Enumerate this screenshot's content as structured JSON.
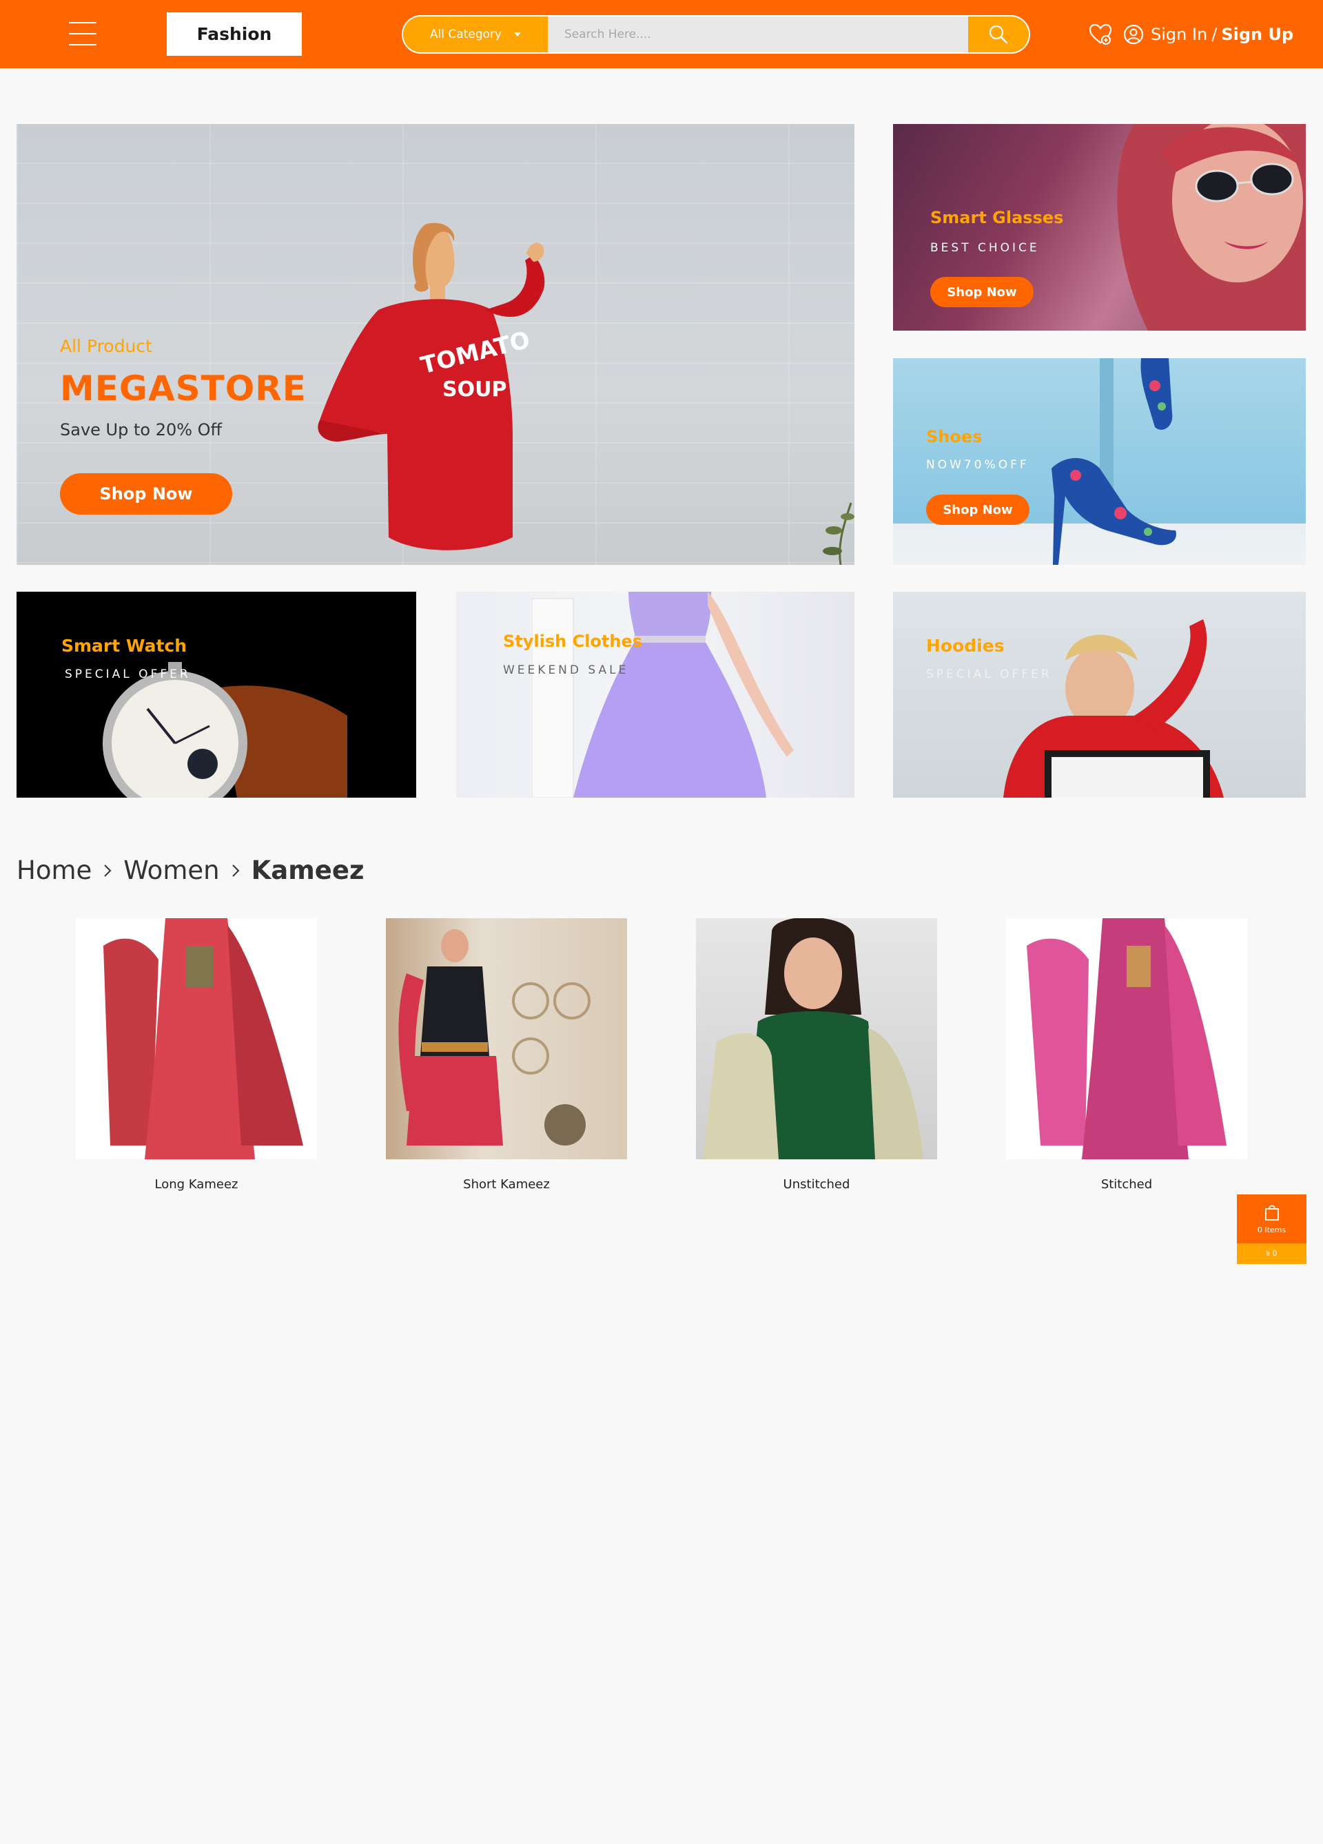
{
  "header": {
    "logo": "Fashion",
    "search": {
      "category": "All Category",
      "placeholder": "Search Here...."
    },
    "auth": {
      "sign_in": "Sign In",
      "separator": "/",
      "sign_up": "Sign Up"
    },
    "icons": [
      "menu-icon",
      "search-icon",
      "wishlist-heart-icon",
      "user-icon"
    ]
  },
  "banners": {
    "main": {
      "category": "All Product",
      "title": "MEGASTORE",
      "subtitle": "Save Up to 20% Off",
      "button": "Shop Now",
      "shirt_text_1": "TOMATO",
      "shirt_text_2": "SOUP"
    },
    "glasses": {
      "title": "Smart Glasses",
      "subtitle": "BEST CHOICE",
      "button": "Shop Now"
    },
    "shoes": {
      "title": "Shoes",
      "subtitle": "NOW70%OFF",
      "button": "Shop Now"
    },
    "watch": {
      "title": "Smart Watch",
      "subtitle": "SPECIAL OFFER"
    },
    "clothes": {
      "title": "Stylish Clothes",
      "subtitle": "WEEKEND SALE"
    },
    "hoodies": {
      "title": "Hoodies",
      "subtitle": "SPECIAL OFFER"
    }
  },
  "breadcrumb": {
    "items": [
      "Home",
      "Women"
    ],
    "current": "Kameez"
  },
  "products": [
    {
      "name": "Long Kameez"
    },
    {
      "name": "Short Kameez"
    },
    {
      "name": "Unstitched"
    },
    {
      "name": "Stitched"
    }
  ],
  "cart": {
    "items_label": "0 Items",
    "total": "৳ 0"
  },
  "colors": {
    "primary": "#ff6600",
    "accent": "#ffa400",
    "background": "#f8f8f8"
  }
}
